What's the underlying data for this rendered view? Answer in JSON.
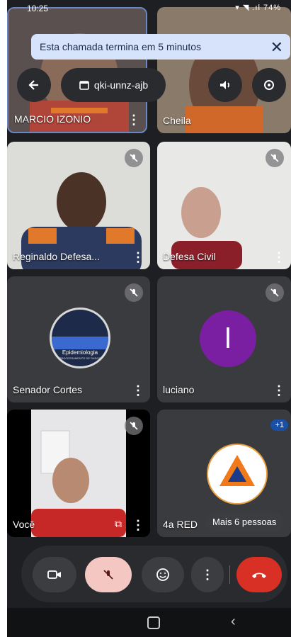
{
  "status_bar": {
    "time": "10:25",
    "right_text": "▾ ◥ .ıl 74%"
  },
  "banner": {
    "text": "Esta chamada termina em 5 minutos",
    "close_icon": "close-icon"
  },
  "meeting": {
    "code": "qki-unnz-ajb"
  },
  "participants": [
    {
      "name": "MARCIO IZONIO"
    },
    {
      "name": "Cheila"
    },
    {
      "name": "Reginaldo Defesa..."
    },
    {
      "name": "Defesa Civil"
    },
    {
      "name": "Senador Cortes"
    },
    {
      "name": "luciano",
      "initial": "l"
    },
    {
      "name": "Você"
    },
    {
      "name": "4a RED"
    }
  ],
  "logo_text": {
    "epidemiologia": "Epidemiologia",
    "sub": "PROCESSAMENTO DE DADOS"
  },
  "more_people": {
    "label": "Mais 6 pessoas",
    "badge": "+1"
  },
  "colors": {
    "accent": "#1a73e8",
    "end_call": "#d93025",
    "mic_off_bg": "#f4c7c3",
    "avatar_purple": "#7b1fa2"
  }
}
